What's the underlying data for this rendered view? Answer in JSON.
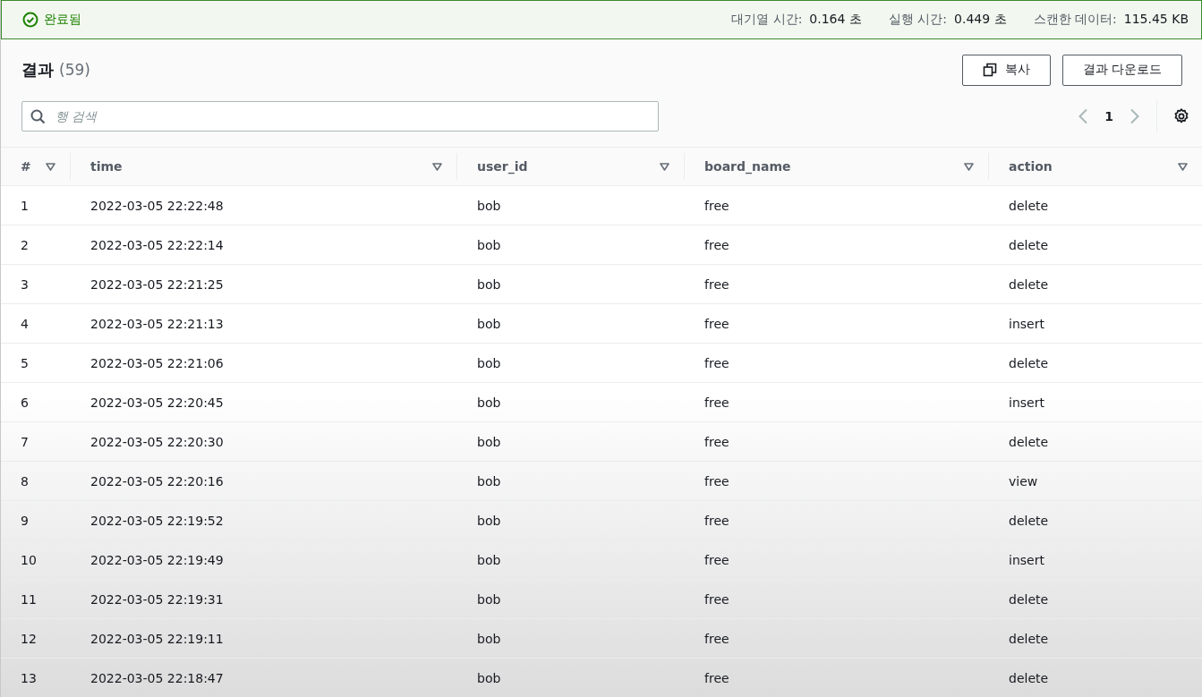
{
  "status_bar": {
    "status": "완료됨",
    "stats": [
      {
        "label": "대기열 시간:",
        "value": "0.164 초"
      },
      {
        "label": "실행 시간:",
        "value": "0.449 초"
      },
      {
        "label": "스캔한 데이터:",
        "value": "115.45 KB"
      }
    ]
  },
  "results": {
    "title": "결과",
    "count": "(59)",
    "buttons": [
      "복사",
      "결과 다운로드"
    ],
    "search": {
      "placeholder": "행 검색"
    },
    "page": "1"
  },
  "table": {
    "columns": [
      "#",
      "time",
      "user_id",
      "board_name",
      "action"
    ],
    "rows": [
      [
        "1",
        "2022-03-05 22:22:48",
        "bob",
        "free",
        "delete"
      ],
      [
        "2",
        "2022-03-05 22:22:14",
        "bob",
        "free",
        "delete"
      ],
      [
        "3",
        "2022-03-05 22:21:25",
        "bob",
        "free",
        "delete"
      ],
      [
        "4",
        "2022-03-05 22:21:13",
        "bob",
        "free",
        "insert"
      ],
      [
        "5",
        "2022-03-05 22:21:06",
        "bob",
        "free",
        "delete"
      ],
      [
        "6",
        "2022-03-05 22:20:45",
        "bob",
        "free",
        "insert"
      ],
      [
        "7",
        "2022-03-05 22:20:30",
        "bob",
        "free",
        "delete"
      ],
      [
        "8",
        "2022-03-05 22:20:16",
        "bob",
        "free",
        "view"
      ],
      [
        "9",
        "2022-03-05 22:19:52",
        "bob",
        "free",
        "delete"
      ],
      [
        "10",
        "2022-03-05 22:19:49",
        "bob",
        "free",
        "insert"
      ],
      [
        "11",
        "2022-03-05 22:19:31",
        "bob",
        "free",
        "delete"
      ],
      [
        "12",
        "2022-03-05 22:19:11",
        "bob",
        "free",
        "delete"
      ],
      [
        "13",
        "2022-03-05 22:18:47",
        "bob",
        "free",
        "delete"
      ]
    ]
  }
}
